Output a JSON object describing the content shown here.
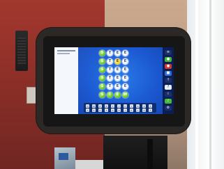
{
  "photo": {
    "subject": "Touchscreen word game kiosk",
    "game": {
      "left_panel_title": "",
      "grid": [
        [
          {
            "letter": "S",
            "color": "green"
          },
          {
            "letter": "T",
            "color": "white"
          },
          {
            "letter": "E",
            "color": "white"
          },
          {
            "letter": "E",
            "color": "white"
          }
        ],
        [
          {
            "letter": "S",
            "color": "green"
          },
          {
            "letter": "T",
            "color": "white"
          },
          {
            "letter": "E",
            "color": "yellow"
          },
          {
            "letter": "E",
            "color": "white"
          }
        ],
        [
          {
            "letter": "S",
            "color": "green"
          },
          {
            "letter": "T",
            "color": "white"
          },
          {
            "letter": "E",
            "color": "white"
          },
          {
            "letter": "E",
            "color": "white"
          }
        ],
        [
          {
            "letter": "S",
            "color": "green"
          },
          {
            "letter": "T",
            "color": "white"
          },
          {
            "letter": "E",
            "color": "white"
          },
          {
            "letter": "E",
            "color": "white"
          }
        ],
        [
          {
            "letter": "S",
            "color": "green"
          },
          {
            "letter": "T",
            "color": "white"
          },
          {
            "letter": "E",
            "color": "white"
          },
          {
            "letter": "E",
            "color": "white"
          }
        ],
        [
          {
            "letter": "S",
            "color": "green"
          },
          {
            "letter": "T",
            "color": "green"
          },
          {
            "letter": "E",
            "color": "green"
          },
          {
            "letter": "W",
            "color": "green"
          }
        ]
      ],
      "keyboard_rows": [
        [
          "Q",
          "W",
          "E",
          "R",
          "T",
          "Y",
          "U",
          "I",
          "O",
          "P",
          "Å"
        ],
        [
          "A",
          "S",
          "D",
          "F",
          "G",
          "H",
          "J",
          "K",
          "L",
          "Ö",
          "Ä"
        ]
      ],
      "sidebar_icons": [
        {
          "name": "menu-icon",
          "glyph": "≡",
          "color": "dark"
        },
        {
          "name": "green-icon",
          "glyph": "●",
          "color": "green"
        },
        {
          "name": "red-icon",
          "glyph": "●",
          "color": "red"
        },
        {
          "name": "blue-icon",
          "glyph": "■",
          "color": "blue"
        },
        {
          "name": "arrow-icon",
          "glyph": "↑",
          "color": "dark"
        },
        {
          "name": "help-icon",
          "glyph": "?",
          "color": "white"
        },
        {
          "name": "info-icon",
          "glyph": "i",
          "color": "dark"
        },
        {
          "name": "sound-icon",
          "glyph": "♪",
          "color": "green"
        },
        {
          "name": "settings-icon",
          "glyph": "⚙",
          "color": "dark"
        }
      ]
    }
  },
  "colors": {
    "screen_blue": "#1d54c8",
    "tile_green": "#6ecb2a",
    "tile_white": "#e8eef6",
    "tile_yellow": "#f2d23a"
  }
}
